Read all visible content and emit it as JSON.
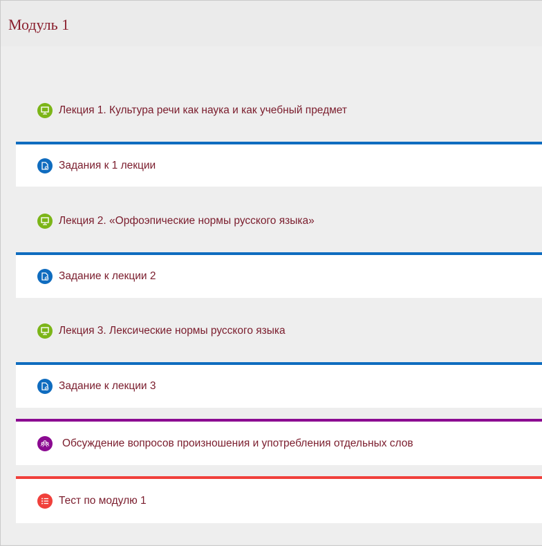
{
  "module": {
    "title": "Модуль 1"
  },
  "activities": [
    {
      "label": "Лекция 1. Культура речи как наука и как учебный предмет",
      "icon": "presentation-icon",
      "color": "#7cb518"
    },
    {
      "label": "Задания к 1 лекции",
      "icon": "assignment-icon",
      "color": "#0f6cbf"
    },
    {
      "label": "Лекция 2. «Орфоэпические нормы русского языка»",
      "icon": "presentation-icon",
      "color": "#7cb518"
    },
    {
      "label": "Задание к лекции 2",
      "icon": "assignment-icon",
      "color": "#0f6cbf"
    },
    {
      "label": "Лекция 3. Лексические нормы русского языка",
      "icon": "presentation-icon",
      "color": "#7cb518"
    },
    {
      "label": "Задание к лекции 3",
      "icon": "assignment-icon",
      "color": "#0f6cbf"
    },
    {
      "label": "Обсуждение вопросов произношения и употребления отдельных слов",
      "icon": "forum-icon",
      "color": "#8b0a91"
    },
    {
      "label": "Тест по модулю 1",
      "icon": "quiz-icon",
      "color": "#f0403b"
    }
  ]
}
